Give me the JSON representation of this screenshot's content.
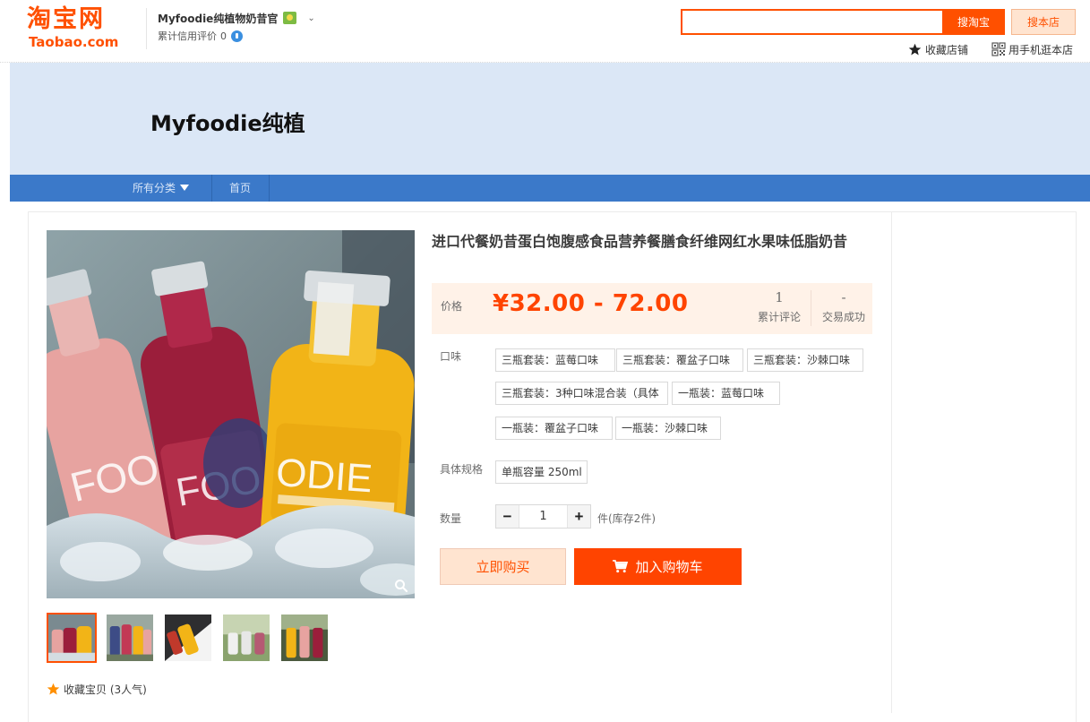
{
  "header": {
    "logo_cn": "淘宝网",
    "logo_en": "Taobao.com",
    "shop_name": "Myfoodie纯植物奶昔官",
    "rating_label": "累计信用评价",
    "rating_value": "0",
    "search_placeholder": "",
    "search_taobao_label": "搜淘宝",
    "search_shop_label": "搜本店",
    "fav_shop_label": "收藏店铺",
    "mobile_shop_label": "用手机逛本店"
  },
  "banner": {
    "title": "Myfoodie纯植"
  },
  "nav": {
    "all_categories": "所有分类",
    "home": "首页"
  },
  "product": {
    "title": "进口代餐奶昔蛋白饱腹感食品营养餐膳食纤维网红水果味低脂奶昔",
    "price_label": "价格",
    "price": "¥32.00 - 72.00",
    "reviews_count": "1",
    "reviews_label": "累计评论",
    "deals_count": "-",
    "deals_label": "交易成功",
    "flavor_label": "口味",
    "flavors": [
      "三瓶套装：蓝莓口味",
      "三瓶套装：覆盆子口味",
      "三瓶套装：沙棘口味",
      "三瓶套装：3种口味混合装（具体",
      "一瓶装：蓝莓口味",
      "一瓶装：覆盆子口味",
      "一瓶装：沙棘口味"
    ],
    "spec_label": "具体规格",
    "specs": [
      "单瓶容量 250ml"
    ],
    "qty_label": "数量",
    "qty_minus": "−",
    "qty_value": "1",
    "qty_plus": "+",
    "stock_text": "件(库存2件)",
    "buy_now_label": "立即购买",
    "add_to_cart_label": "加入购物车",
    "fav_item_label": "收藏宝贝 (3人气)"
  },
  "colors": {
    "brand_orange": "#ff5000",
    "price_red": "#ff4400",
    "nav_blue": "#3b79c9",
    "banner_bg": "#dbe7f6",
    "price_bg": "#fff2e8"
  },
  "icons": {
    "fav_shop": "star-icon",
    "mobile_shop": "qr-code-icon",
    "zoom": "search-icon",
    "cart": "cart-icon",
    "fav_item": "star-icon"
  }
}
